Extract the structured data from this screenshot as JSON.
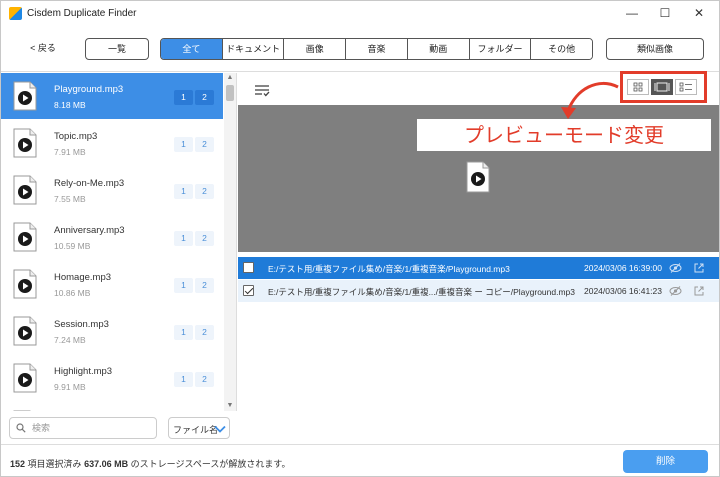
{
  "window": {
    "title": "Cisdem Duplicate Finder",
    "minimize": "—",
    "maximize": "☐",
    "close": "✕"
  },
  "toolbar": {
    "back_label": "< 戻る",
    "overview_label": "一覧",
    "tabs": [
      {
        "label": "全て",
        "active": true
      },
      {
        "label": "ドキュメント"
      },
      {
        "label": "画像"
      },
      {
        "label": "音楽"
      },
      {
        "label": "動画"
      },
      {
        "label": "フォルダー"
      },
      {
        "label": "その他"
      }
    ],
    "similar_label": "類似画像"
  },
  "files": [
    {
      "name": "Playground.mp3",
      "size": "8.18 MB",
      "badges": [
        "1",
        "2"
      ]
    },
    {
      "name": "Topic.mp3",
      "size": "7.91 MB",
      "badges": [
        "1",
        "2"
      ]
    },
    {
      "name": "Rely-on-Me.mp3",
      "size": "7.55 MB",
      "badges": [
        "1",
        "2"
      ]
    },
    {
      "name": "Anniversary.mp3",
      "size": "10.59 MB",
      "badges": [
        "1",
        "2"
      ]
    },
    {
      "name": "Homage.mp3",
      "size": "10.86 MB",
      "badges": [
        "1",
        "2"
      ]
    },
    {
      "name": "Session.mp3",
      "size": "7.24 MB",
      "badges": [
        "1",
        "2"
      ]
    },
    {
      "name": "Highlight.mp3",
      "size": "9.91 MB",
      "badges": [
        "1",
        "2"
      ]
    }
  ],
  "search": {
    "placeholder": "検索",
    "value": ""
  },
  "sort": {
    "selected": "ファイル名"
  },
  "preview": {
    "annotation": "プレビューモード変更"
  },
  "duplicates": [
    {
      "checked": false,
      "path": "E:/テスト用/重複ファイル集め/音楽/1/重複音楽/Playground.mp3",
      "date": "2024/03/06 16:39:00"
    },
    {
      "checked": true,
      "path": "E:/テスト用/重複ファイル集め/音楽/1/重複.../重複音楽 ー コピー/Playground.mp3",
      "date": "2024/03/06 16:41:23"
    }
  ],
  "status": {
    "count": "152",
    "count_label": "項目選択済み",
    "size": "637.06 MB",
    "size_label": "のストレージスペースが解放されます。"
  },
  "delete_label": "削除",
  "colors": {
    "accent": "#3d8ee6",
    "annotation": "#e23c2a",
    "preview_bg": "#7f7f7f"
  }
}
